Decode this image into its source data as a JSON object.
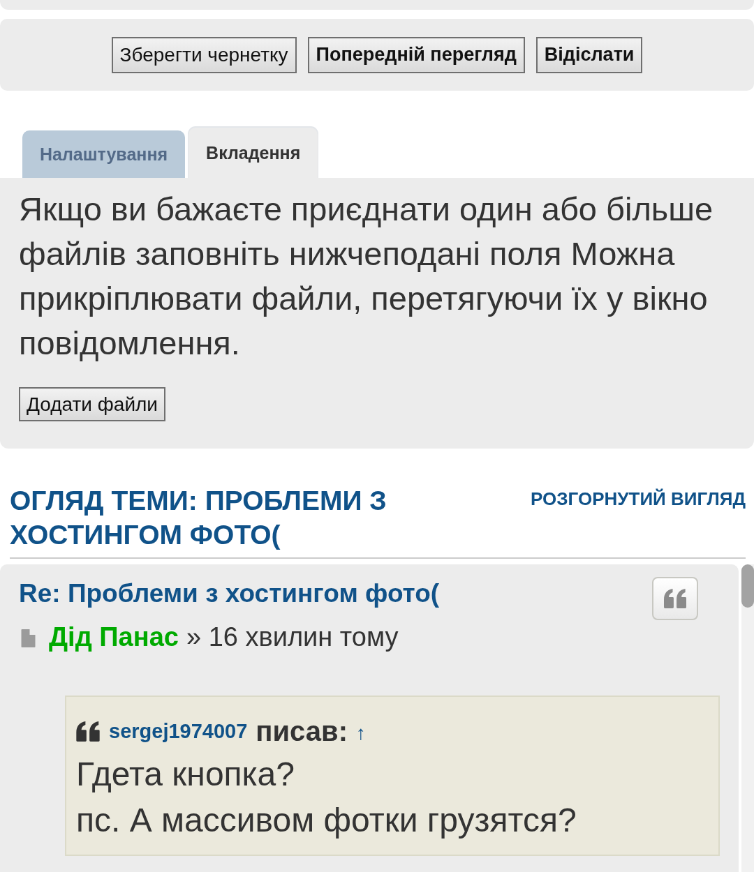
{
  "form_buttons": [
    {
      "label": "Зберегти чернетку",
      "kind": "secondary"
    },
    {
      "label": "Попередній перегляд",
      "kind": "primary"
    },
    {
      "label": "Відіслати",
      "kind": "primary"
    }
  ],
  "tabs": [
    {
      "label": "Налаштування",
      "selected": false
    },
    {
      "label": "Вкладення",
      "selected": true
    }
  ],
  "attachments_panel": {
    "text": "Якщо ви бажаєте приєднати один або більше файлів заповніть нижчеподані поля Можна прикріплювати файли, перетягуючи їх у вікно повідомлення.",
    "button": "Додати файли"
  },
  "topic_review": {
    "title": "ОГЛЯД ТЕМИ: ПРОБЛЕМИ З ХОСТИНГОМ ФОТО(",
    "expand_link": "РОЗГОРНУТИЙ ВИГЛЯД",
    "posts": [
      {
        "title": "Re: Проблеми з хостингом фото(",
        "author": "Дід Панас",
        "time": "» 16 хвилин тому",
        "quote": {
          "author": "sergej1974007",
          "wrote": "писав:",
          "link": "↑",
          "lines": [
            "Гдета кнопка?",
            "пс. А массивом фотки грузятся?"
          ]
        }
      }
    ]
  }
}
